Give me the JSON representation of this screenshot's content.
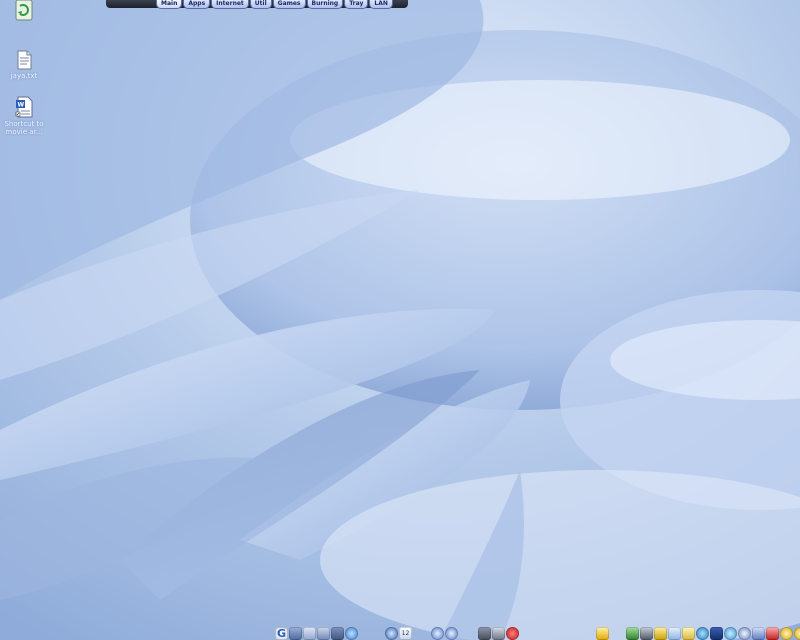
{
  "top_dock": {
    "tabs": [
      {
        "label": "Main",
        "active": true
      },
      {
        "label": "Apps",
        "active": false
      },
      {
        "label": "Internet",
        "active": false
      },
      {
        "label": "Util",
        "active": false
      },
      {
        "label": "Games",
        "active": false
      },
      {
        "label": "Burning",
        "active": false
      },
      {
        "label": "Tray",
        "active": false
      },
      {
        "label": "LAN",
        "active": false
      }
    ]
  },
  "desktop_icons": [
    {
      "label": "",
      "icon": "recycle-bin-icon"
    },
    {
      "label": "jaya.txt",
      "icon": "text-file-icon"
    },
    {
      "label": "Shortcut to movie ar...",
      "icon": "word-document-icon"
    }
  ],
  "colors": {
    "wallpaper_light": "#eef4ff",
    "wallpaper_mid": "#b3c9ea",
    "wallpaper_dark": "#6f93cc",
    "tab_text": "#1a2a66"
  }
}
